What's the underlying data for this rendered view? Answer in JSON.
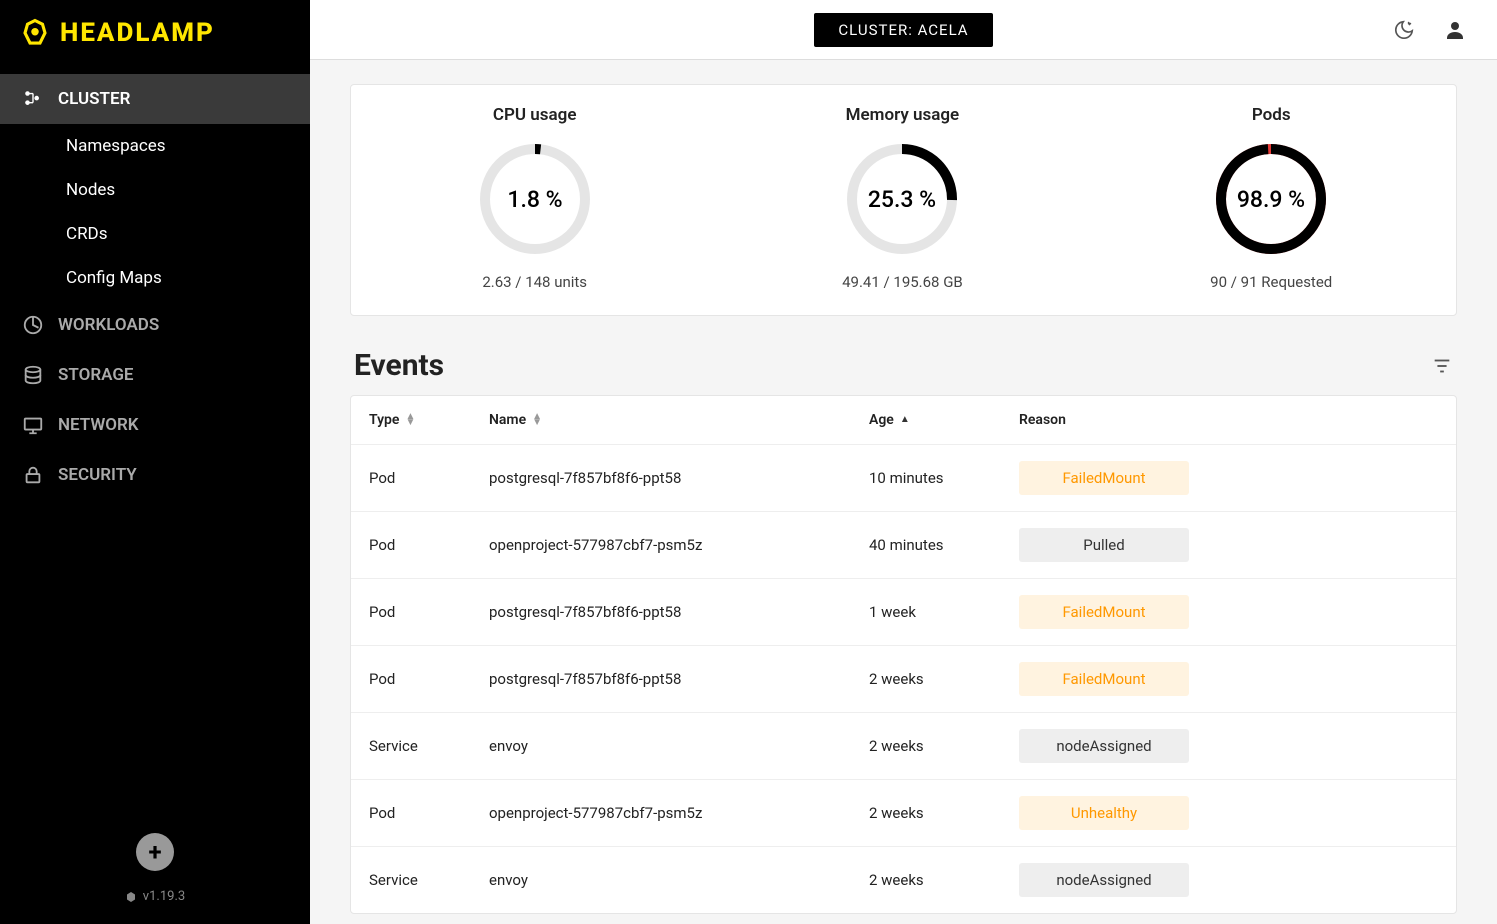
{
  "logo_text": "HEADLAMP",
  "topbar": {
    "cluster_label": "CLUSTER: ACELA"
  },
  "sidebar": {
    "items": [
      {
        "label": "CLUSTER",
        "active": true,
        "icon": "cluster"
      },
      {
        "label": "WORKLOADS",
        "active": false,
        "icon": "workloads"
      },
      {
        "label": "STORAGE",
        "active": false,
        "icon": "storage"
      },
      {
        "label": "NETWORK",
        "active": false,
        "icon": "network"
      },
      {
        "label": "SECURITY",
        "active": false,
        "icon": "security"
      }
    ],
    "cluster_sub": [
      "Namespaces",
      "Nodes",
      "CRDs",
      "Config Maps"
    ]
  },
  "version": "v1.19.3",
  "gauges": [
    {
      "title": "CPU usage",
      "percent": 1.8,
      "display": "1.8 %",
      "sub": "2.63 / 148 units",
      "fill_frac": 0.018,
      "color": "#000"
    },
    {
      "title": "Memory usage",
      "percent": 25.3,
      "display": "25.3 %",
      "sub": "49.41 / 195.68 GB",
      "fill_frac": 0.253,
      "color": "#000"
    },
    {
      "title": "Pods",
      "percent": 98.9,
      "display": "98.9 %",
      "sub": "90 / 91 Requested",
      "fill_frac": 0.989,
      "color": "#000",
      "gap_color": "#e53935"
    }
  ],
  "events": {
    "title": "Events",
    "columns": [
      "Type",
      "Name",
      "Age",
      "Reason"
    ],
    "rows": [
      {
        "type": "Pod",
        "name": "postgresql-7f857bf8f6-ppt58",
        "age": "10 minutes",
        "reason": "FailedMount",
        "status": "warn"
      },
      {
        "type": "Pod",
        "name": "openproject-577987cbf7-psm5z",
        "age": "40 minutes",
        "reason": "Pulled",
        "status": "normal"
      },
      {
        "type": "Pod",
        "name": "postgresql-7f857bf8f6-ppt58",
        "age": "1 week",
        "reason": "FailedMount",
        "status": "warn"
      },
      {
        "type": "Pod",
        "name": "postgresql-7f857bf8f6-ppt58",
        "age": "2 weeks",
        "reason": "FailedMount",
        "status": "warn"
      },
      {
        "type": "Service",
        "name": "envoy",
        "age": "2 weeks",
        "reason": "nodeAssigned",
        "status": "normal"
      },
      {
        "type": "Pod",
        "name": "openproject-577987cbf7-psm5z",
        "age": "2 weeks",
        "reason": "Unhealthy",
        "status": "warn"
      },
      {
        "type": "Service",
        "name": "envoy",
        "age": "2 weeks",
        "reason": "nodeAssigned",
        "status": "normal"
      }
    ]
  }
}
